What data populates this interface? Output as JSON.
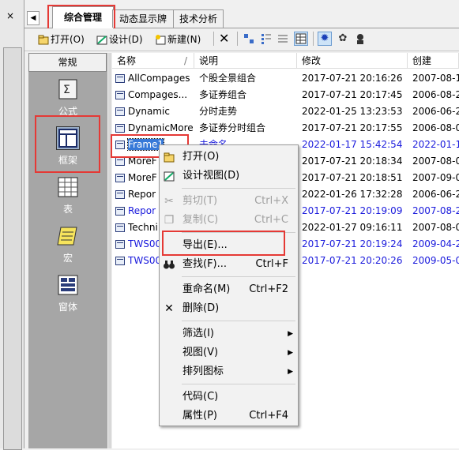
{
  "left_strip": {
    "close_icon": "×"
  },
  "tabs": [
    {
      "label": "综合管理",
      "active": true
    },
    {
      "label": "动态显示牌",
      "active": false
    },
    {
      "label": "技术分析",
      "active": false
    }
  ],
  "toolbar": {
    "open": "打开(O)",
    "design": "设计(D)",
    "new": "新建(N)"
  },
  "categories": {
    "header": "常规",
    "items": [
      {
        "label": "公式",
        "icon": "formula-icon"
      },
      {
        "label": "框架",
        "icon": "frame-icon"
      },
      {
        "label": "表",
        "icon": "table-icon"
      },
      {
        "label": "宏",
        "icon": "macro-icon"
      },
      {
        "label": "窗体",
        "icon": "form-icon"
      }
    ]
  },
  "list": {
    "columns": [
      "名称",
      "说明",
      "修改",
      "创建"
    ],
    "rows": [
      {
        "name": "AllCompages",
        "desc": "个股全景组合",
        "modified": "2017-07-21 20:16:26",
        "created": "2007-08-1",
        "blue": false
      },
      {
        "name": "Compages...",
        "desc": "多证券组合",
        "modified": "2017-07-21 20:17:45",
        "created": "2006-08-2",
        "blue": false
      },
      {
        "name": "Dynamic",
        "desc": "分时走势",
        "modified": "2022-01-25 13:23:53",
        "created": "2006-06-2",
        "blue": false
      },
      {
        "name": "DynamicMore",
        "desc": "多证券分时组合",
        "modified": "2017-07-21 20:17:55",
        "created": "2006-08-0",
        "blue": false
      },
      {
        "name": "Frame1",
        "desc": "未命名",
        "modified": "2022-01-17 15:42:54",
        "created": "2022-01-1",
        "blue": true,
        "selected": true
      },
      {
        "name": "MoreF",
        "desc": "",
        "modified": "2017-07-21 20:18:34",
        "created": "2007-08-0",
        "blue": false
      },
      {
        "name": "MoreF",
        "desc": "",
        "modified": "2017-07-21 20:18:51",
        "created": "2007-09-0",
        "blue": false
      },
      {
        "name": "Repor",
        "desc": "",
        "modified": "2022-01-26 17:32:28",
        "created": "2006-06-2",
        "blue": false
      },
      {
        "name": "Repor",
        "desc": "",
        "modified": "2017-07-21 20:19:09",
        "created": "2007-08-2",
        "blue": true
      },
      {
        "name": "Techni",
        "desc": "",
        "modified": "2022-01-27 09:16:11",
        "created": "2007-08-0",
        "blue": false
      },
      {
        "name": "TWS00",
        "desc": "",
        "modified": "2017-07-21 20:19:24",
        "created": "2009-04-2",
        "blue": true
      },
      {
        "name": "TWS00",
        "desc": "",
        "modified": "2017-07-21 20:20:26",
        "created": "2009-05-0",
        "blue": true
      }
    ]
  },
  "context_menu": {
    "open": "打开(O)",
    "design_view": "设计视图(D)",
    "cut": "剪切(T)",
    "cut_sc": "Ctrl+X",
    "copy": "复制(C)",
    "copy_sc": "Ctrl+C",
    "export": "导出(E)...",
    "find": "查找(F)...",
    "find_sc": "Ctrl+F",
    "rename": "重命名(M)",
    "rename_sc": "Ctrl+F2",
    "delete": "删除(D)",
    "filter": "筛选(I)",
    "view": "视图(V)",
    "arrange": "排列图标",
    "code": "代码(C)",
    "properties": "属性(P)",
    "properties_sc": "Ctrl+F4"
  },
  "colors": {
    "highlight_red": "#e53935",
    "selection_blue": "#3779d8",
    "list_blue": "#1a1adc"
  }
}
